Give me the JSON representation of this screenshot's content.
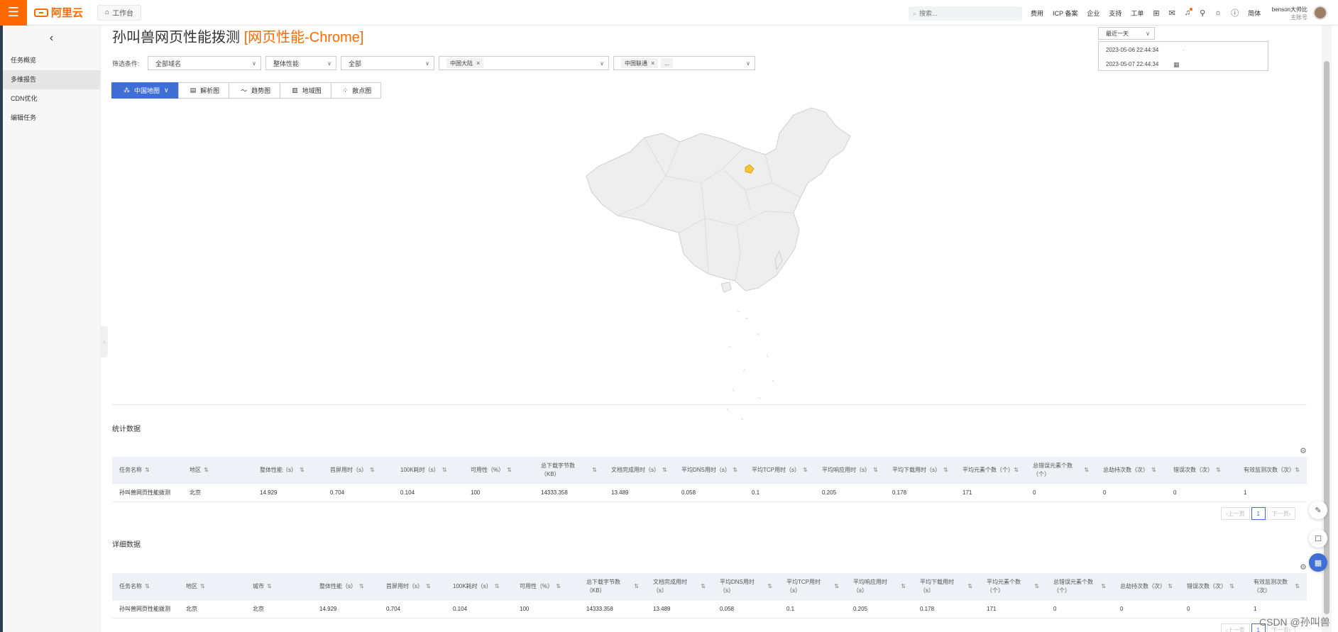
{
  "topbar": {
    "logo_text": "阿里云",
    "workbench": "工作台",
    "search_placeholder": "搜索...",
    "links": [
      "费用",
      "ICP 备案",
      "企业",
      "支持",
      "工单"
    ],
    "lang": "简体",
    "user_name": "benson大帅比",
    "user_role": "主账号"
  },
  "sidebar": {
    "items": [
      {
        "label": "任务概览",
        "active": false
      },
      {
        "label": "多维报告",
        "active": true
      },
      {
        "label": "CDN优化",
        "active": false
      },
      {
        "label": "编辑任务",
        "active": false
      }
    ]
  },
  "main": {
    "title": "孙叫兽网页性能拨测",
    "title_suffix": "[网页性能-Chrome]",
    "filter": {
      "label": "筛选条件:",
      "domain": "全部域名",
      "metric": "整体性能",
      "scope": "全部",
      "region_tag": "中国大陆",
      "isp_tag": "中国联通",
      "isp_more": "..."
    },
    "date": {
      "preset": "最近一天",
      "start": "2023-05-06 22:44:34",
      "end": "2023-05-07 22:44:34",
      "sep": "-"
    },
    "view_tabs": [
      "中国地图",
      "解析图",
      "趋势图",
      "地域图",
      "散点图"
    ]
  },
  "stats": {
    "title": "统计数据",
    "headers": [
      "任务名称",
      "地区",
      "整体性能（s）",
      "首屏用时（s）",
      "100K耗时（s）",
      "可用性（%）",
      "总下载字节数（KB）",
      "文档完成用时（s）",
      "平均DNS用时（s）",
      "平均TCP用时（s）",
      "平均响应用时（s）",
      "平均下载用时（s）",
      "平均元素个数（个）",
      "总错误元素个数（个）",
      "总劫持次数（次）",
      "错误次数（次）",
      "有效监测次数（次）"
    ],
    "rows": [
      [
        "孙叫兽网页性能拨测",
        "北京",
        "14.929",
        "0.704",
        "0.104",
        "100",
        "14333.358",
        "13.489",
        "0.058",
        "0.1",
        "0.205",
        "0.178",
        "171",
        "0",
        "0",
        "0",
        "1"
      ]
    ]
  },
  "detail": {
    "title": "详细数据",
    "headers": [
      "任务名称",
      "地区",
      "城市",
      "整体性能（s）",
      "首屏用时（s）",
      "100K耗时（s）",
      "可用性（%）",
      "总下载字节数（KB）",
      "文档完成用时（s）",
      "平均DNS用时（s）",
      "平均TCP用时（s）",
      "平均响应用时（s）",
      "平均下载用时（s）",
      "平均元素个数（个）",
      "总错误元素个数（个）",
      "总劫持次数（次）",
      "错误次数（次）",
      "有效监测次数（次）"
    ],
    "rows": [
      [
        "孙叫兽网页性能拨测",
        "北京",
        "北京",
        "14.929",
        "0.704",
        "0.104",
        "100",
        "14333.358",
        "13.489",
        "0.058",
        "0.1",
        "0.205",
        "0.178",
        "171",
        "0",
        "0",
        "0",
        "1"
      ]
    ]
  },
  "pager": {
    "prev": "上一页",
    "page": "1",
    "next": "下一页"
  },
  "watermark": "CSDN @孙叫兽",
  "colors": {
    "brand": "#ff6a00",
    "active_tab": "#3f6ed4",
    "map_fill": "#eeeeee",
    "highlight": "#f5c542"
  }
}
